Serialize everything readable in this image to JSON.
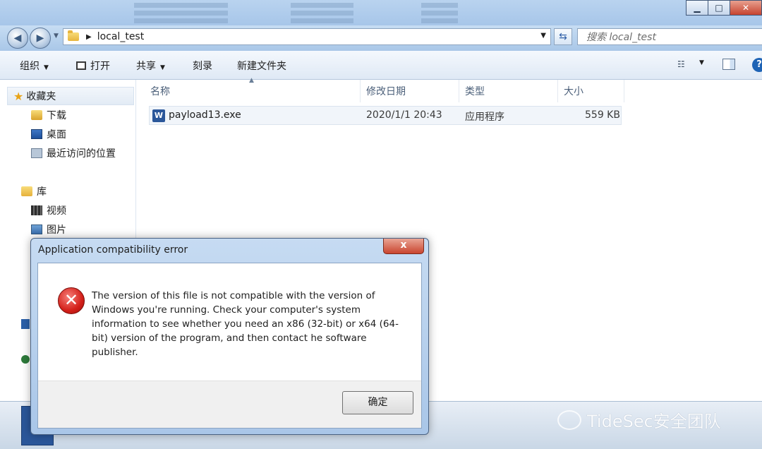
{
  "address": {
    "breadcrumb": "local_test"
  },
  "search": {
    "placeholder": "搜索 local_test"
  },
  "toolbar": {
    "organize": "组织",
    "open": "打开",
    "share": "共享",
    "burn": "刻录",
    "new_folder": "新建文件夹"
  },
  "sidebar": {
    "favorites": "收藏夹",
    "items": [
      "下载",
      "桌面",
      "最近访问的位置"
    ],
    "libraries": "库",
    "lib_items": [
      "视频",
      "图片"
    ]
  },
  "file_list": {
    "headers": {
      "name": "名称",
      "modified": "修改日期",
      "type": "类型",
      "size": "大小"
    },
    "rows": [
      {
        "name": "payload13.exe",
        "modified": "2020/1/1 20:43",
        "type": "应用程序",
        "size": "559 KB"
      }
    ]
  },
  "dialog": {
    "title": "Application compatibility error",
    "message": "The version of this file is not compatible with the version of Windows you're running. Check your computer's system information to see whether you need an x86 (32-bit) or x64 (64-bit) version of the program, and then contact he software publisher.",
    "ok_label": "确定",
    "close_glyph": "x"
  },
  "watermark": {
    "text": "TideSec安全团队"
  },
  "colors": {
    "accent": "#2b579a",
    "error": "#d4201a",
    "window_chrome": "#a9c7e8"
  }
}
